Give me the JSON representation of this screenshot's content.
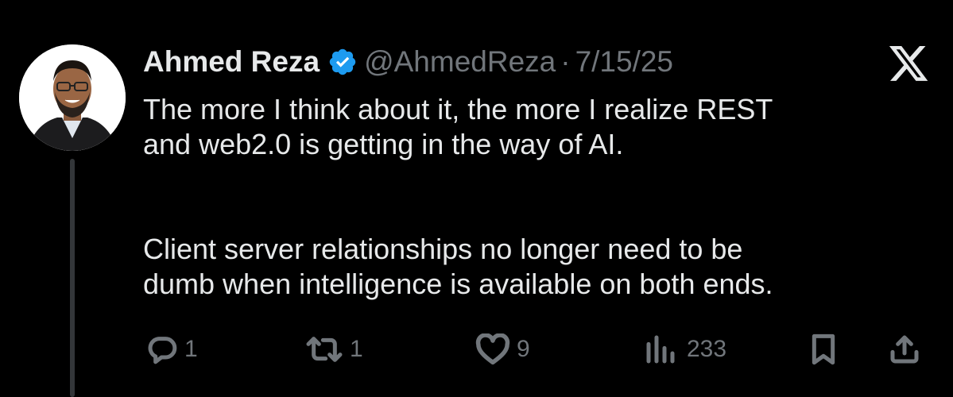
{
  "author": {
    "display_name": "Ahmed Reza",
    "handle": "@AhmedReza",
    "separator": "·",
    "date": "7/15/25",
    "verified": true
  },
  "tweet": {
    "paragraphs": [
      [
        "The more I think about it, the more I realize REST",
        "and web2.0 is getting in the way of AI."
      ],
      [
        "Client server relationships no longer need to be",
        "dumb when intelligence is available on both ends."
      ]
    ]
  },
  "actions": {
    "reply_count": "1",
    "retweet_count": "1",
    "like_count": "9",
    "views_count": "233"
  },
  "icons": {
    "brand": "x-logo-icon",
    "verified": "verified-badge-icon",
    "reply": "reply-icon",
    "retweet": "retweet-icon",
    "like": "heart-icon",
    "views": "views-chart-icon",
    "bookmark": "bookmark-icon",
    "share": "share-icon"
  },
  "colors": {
    "background": "#000000",
    "text": "#e7e9ea",
    "muted": "#71767b",
    "verified": "#1d9bf0",
    "thread_line": "#333639"
  }
}
